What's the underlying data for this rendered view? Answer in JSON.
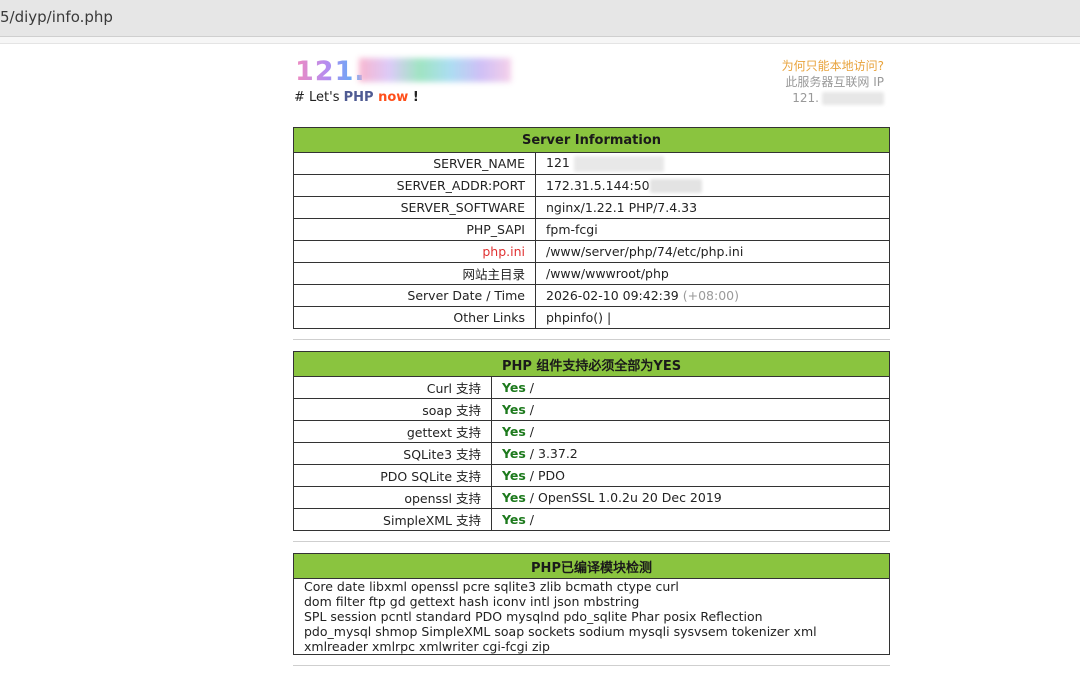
{
  "browser": {
    "url": "5/diyp/info.php"
  },
  "header": {
    "host_prefix": "121.",
    "tagline_prefix": "# Let's ",
    "tagline_php": "PHP",
    "tagline_now": " now",
    "tagline_bang": " !"
  },
  "side_note": {
    "why": "为何只能本地访问?",
    "label": "此服务器互联网 IP",
    "ip_prefix": "121."
  },
  "server_info": {
    "title": "Server Information",
    "rows": [
      {
        "key": "SERVER_NAME",
        "value": "121"
      },
      {
        "key": "SERVER_ADDR:PORT",
        "value": "172.31.5.144:50"
      },
      {
        "key": "SERVER_SOFTWARE",
        "value": "nginx/1.22.1 PHP/7.4.33"
      },
      {
        "key": "PHP_SAPI",
        "value": "fpm-fcgi"
      },
      {
        "key": "php.ini",
        "value": "/www/server/php/74/etc/php.ini"
      },
      {
        "key": "网站主目录",
        "value": "/www/wwwroot/php"
      },
      {
        "key": "Server Date / Time",
        "value": "2026-02-10 09:42:39",
        "value_extra": "(+08:00)"
      },
      {
        "key": "Other Links",
        "value": "phpinfo() |"
      }
    ]
  },
  "php_support": {
    "title": "PHP 组件支持必须全部为YES",
    "yes": "Yes",
    "rows": [
      {
        "key": "Curl 支持",
        "detail": " /"
      },
      {
        "key": "soap 支持",
        "detail": " /"
      },
      {
        "key": "gettext 支持",
        "detail": " /"
      },
      {
        "key": "SQLite3 支持",
        "detail": " / 3.37.2"
      },
      {
        "key": "PDO SQLite 支持",
        "detail": " / PDO"
      },
      {
        "key": "openssl 支持",
        "detail": " / OpenSSL 1.0.2u 20 Dec 2019"
      },
      {
        "key": "SimpleXML 支持",
        "detail": " /"
      }
    ]
  },
  "modules": {
    "title": "PHP已编译模块检测",
    "lines": [
      "Core  date  libxml  openssl  pcre  sqlite3  zlib  bcmath  ctype  curl",
      "dom  filter  ftp  gd  gettext  hash  iconv  intl  json  mbstring",
      "SPL  session  pcntl  standard  PDO  mysqlnd  pdo_sqlite  Phar  posix  Reflection",
      "pdo_mysql  shmop  SimpleXML  soap  sockets  sodium  mysqli  sysvsem  tokenizer  xml",
      "xmlreader  xmlrpc  xmlwriter  cgi-fcgi  zip"
    ]
  }
}
